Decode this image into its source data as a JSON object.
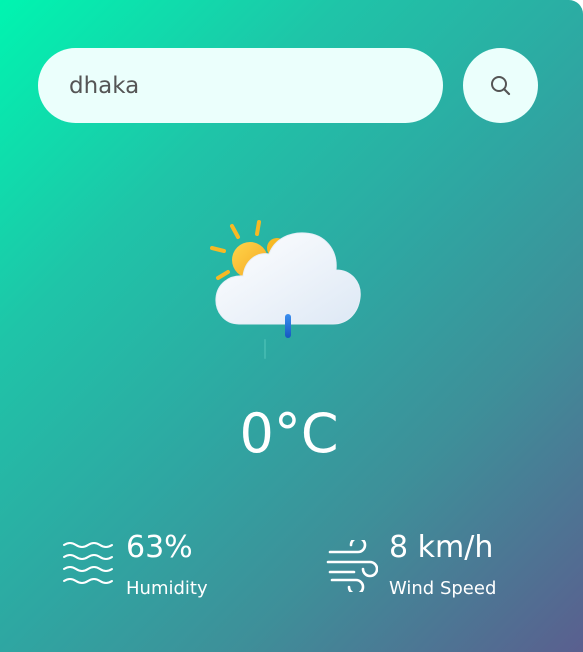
{
  "search": {
    "value": "dhaka",
    "placeholder": "",
    "button_icon": "search-icon"
  },
  "weather": {
    "icon": "partly-cloudy-rain-icon",
    "temperature": "0°C"
  },
  "humidity": {
    "icon": "waves-icon",
    "value": "63%",
    "label": "Humidity"
  },
  "wind": {
    "icon": "wind-icon",
    "value": "8 km/h",
    "label": "Wind Speed"
  },
  "colors": {
    "gradient_start": "#00f5b0",
    "gradient_end": "#5a5f8f",
    "field_background": "#ebfffc",
    "text": "#ffffff"
  }
}
